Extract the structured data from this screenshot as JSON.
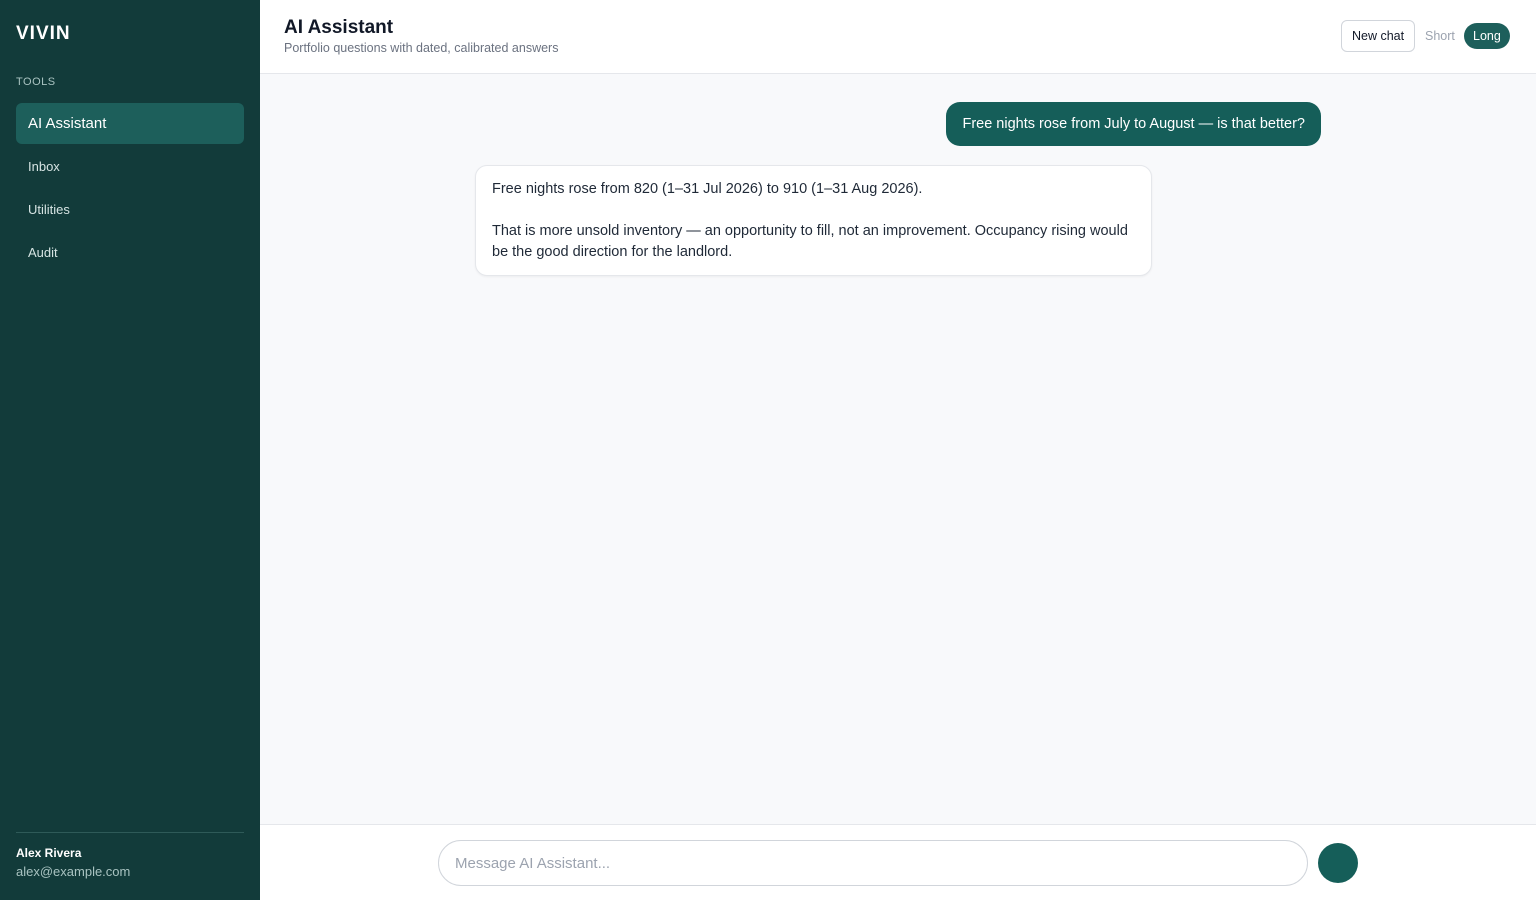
{
  "sidebar": {
    "brand": "VIVIN",
    "section_label": "TOOLS",
    "items": [
      {
        "label": "AI Assistant",
        "active": true
      },
      {
        "label": "Inbox",
        "active": false
      },
      {
        "label": "Utilities",
        "active": false
      },
      {
        "label": "Audit",
        "active": false
      }
    ],
    "user": {
      "name": "Alex Rivera",
      "email": "alex@example.com"
    }
  },
  "header": {
    "title": "AI Assistant",
    "subtitle": "Portfolio questions with dated, calibrated answers",
    "new_chat_label": "New chat",
    "length_toggle": {
      "short_label": "Short",
      "long_label": "Long",
      "selected": "Long"
    }
  },
  "chat": {
    "messages": [
      {
        "role": "user",
        "text": "Free nights rose from July to August — is that better?"
      },
      {
        "role": "assistant",
        "paragraphs": [
          "Free nights rose from 820 (1–31 Jul 2026) to 910 (1–31 Aug 2026).",
          "That is more unsold inventory — an opportunity to fill, not an improvement. Occupancy rising would be the good direction for the landlord."
        ]
      }
    ]
  },
  "composer": {
    "placeholder": "Message AI Assistant...",
    "value": ""
  },
  "colors": {
    "sidebar_bg": "#123b3a",
    "accent": "#155e59",
    "active_nav": "#1d5f5b"
  }
}
